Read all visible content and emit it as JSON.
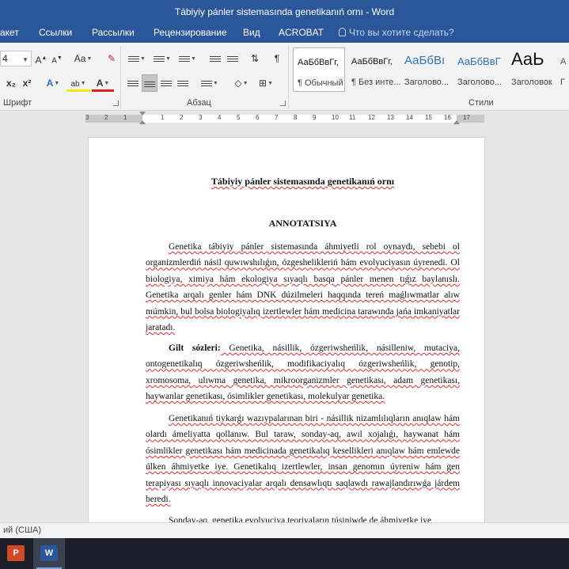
{
  "window": {
    "title": "Tábiyiy pánler sistemasında genetikanıń ornı - Word"
  },
  "ribbon_tabs": [
    "акет",
    "Ссылки",
    "Рассылки",
    "Рецензирование",
    "Вид",
    "ACROBAT"
  ],
  "tell_me": {
    "placeholder": "Что вы хотите сделать?"
  },
  "font_group": {
    "size_value": "4",
    "grow_label": "A",
    "shrink_label": "A",
    "case_label": "Aa",
    "subscript_label": "x₂",
    "superscript_label": "x²",
    "effects_label": "A",
    "highlight_label": "ab",
    "font_color_label": "A",
    "label": "Шрифт"
  },
  "paragraph_group": {
    "label": "Абзац",
    "pilcrow": "¶"
  },
  "styles_group": {
    "label": "Стили",
    "items": [
      {
        "preview": "АаБбВвГг,",
        "name": "¶ Обычный"
      },
      {
        "preview": "АаБбВвГг,",
        "name": "¶ Без инте..."
      },
      {
        "preview": "АаБбВı",
        "name": "Заголово..."
      },
      {
        "preview": "АаБбВвГ",
        "name": "Заголово..."
      },
      {
        "preview": "АаЬ",
        "name": "Заголовок"
      },
      {
        "preview": "А",
        "name": "Г"
      }
    ]
  },
  "ruler": {
    "numbers": [
      "3",
      "2",
      "1",
      "1",
      "2",
      "3",
      "4",
      "5",
      "6",
      "7",
      "8",
      "9",
      "10",
      "11",
      "12",
      "13",
      "14",
      "15",
      "16",
      "17"
    ]
  },
  "document": {
    "title": "Tábiyiy pánler sistemasında genetikanıń ornı",
    "heading": "ANNOTATSIYA",
    "para1": "Genetika tábiyiy pánler sistemasında áhmiyetli rol oynaydı, sebebi ol organizmlerdiń násil quwıwshılıǵın, ózgeshelikleriń hám evolyuciyasın úyrenedi. Ol biologiya, ximiya hám ekologiya sıyaqlı basqa pánler menen tıǵız baylanıslı. Genetika arqalı genler hám DNK dúzilmeleri haqqında tereń maǵlıwmatlar alıw múmkin, bul bolsa biologiyalıq izertlewler hám medicina tarawında jańa imkaniyatlar jaratadı.",
    "keywords_label": "Gilt sózleri:",
    "keywords_text": " Genetika, násillik, ózgeriwsheńlik, násilleniw, mutaciya, ontogenetikalıq ózgeriwsheńlik, modifikaciyalıq ózgeriwsheńlik, genotip, xromosoma, ulıwma genetika, mikroorganizmler genetikası, adam genetikası, haywanlar genetikası, ósimlikler genetikası, molekulyar genetika.",
    "para3": "Genetikanıń tiykarǵı wazıypalarınan biri - násillik nizamlılıqların anıqlaw hám olardı ámeliyatta qollanıw. Bul taraw, sonday-aq, awıl xojalıǵı, haywanat hám ósimlikler genetikası hám medicinada genetikalıq kesellikleri anıqlaw hám emlewde úlken áhmiyetke iye. Genetikalıq izertlewler, insan genomın úyreniw hám gen terapiyası sıyaqlı innovaciyalar arqalı densawlıqtı saqlawdı rawajlandırıwǵa járdem beredi.",
    "para4": "Sonday-aq, genetika evolyuciya teoriyaların túsiniwde de áhmiyetke iye"
  },
  "status": {
    "language": "ий (США)"
  },
  "taskbar": {
    "ppt_label": "P",
    "word_label": "W"
  }
}
